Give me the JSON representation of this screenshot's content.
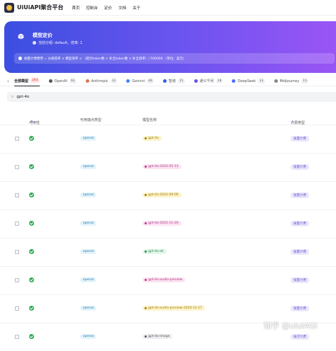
{
  "header": {
    "brand": "UiUiAPI聚合平台",
    "nav": [
      "首页",
      "控制台",
      "定价",
      "文档",
      "关于"
    ]
  },
  "hero": {
    "title": "模型定价",
    "subtitle": "当前分组: default，倍率: 1",
    "formula": "按量计费费用 = 分组倍率 × 模型倍率 × （提示token数 + 补全token数 × 补全倍率）/ 500000 （单位：美元）"
  },
  "tabs": [
    {
      "label": "全部模型",
      "count": "283",
      "color": "#1c1f23"
    },
    {
      "label": "OpenAI",
      "count": "92",
      "color": "#555555"
    },
    {
      "label": "Anthropic",
      "count": "12",
      "color": "#d97757"
    },
    {
      "label": "Gemini",
      "count": "48",
      "color": "#4285f4"
    },
    {
      "label": "智谱",
      "count": "15",
      "color": "#3859ff"
    },
    {
      "label": "通义千问",
      "count": "18",
      "color": "#6e4df2"
    },
    {
      "label": "DeepSeek",
      "count": "13",
      "color": "#4d6bfe"
    },
    {
      "label": "Midjourney",
      "count": "15",
      "color": "#888888"
    }
  ],
  "search": {
    "value": "gpt-4o"
  },
  "table": {
    "columns": [
      "可用性",
      "可用端点类型",
      "模型名称",
      "计费类型"
    ],
    "rows": [
      {
        "endpoint": "openai",
        "model": "gpt-4o",
        "model_bg": "#fbf3c8",
        "model_fg": "#a07a10",
        "billing": "按量计费"
      },
      {
        "endpoint": "openai",
        "model": "gpt-4o-2024-05-13",
        "model_bg": "#fbe3f2",
        "model_fg": "#b13b86",
        "billing": "按量计费"
      },
      {
        "endpoint": "openai",
        "model": "gpt-4o-2024-08-06",
        "model_bg": "#fbf3c8",
        "model_fg": "#a07a10",
        "billing": "按量计费"
      },
      {
        "endpoint": "openai",
        "model": "gpt-4o-2024-11-20",
        "model_bg": "#fbe3f2",
        "model_fg": "#b13b86",
        "billing": "按量计费"
      },
      {
        "endpoint": "openai",
        "model": "gpt-4o-all",
        "model_bg": "#e2f6ea",
        "model_fg": "#2e8a50",
        "billing": "按量计费"
      },
      {
        "endpoint": "openai",
        "model": "gpt-4o-audio-preview",
        "model_bg": "#fbe3f2",
        "model_fg": "#b13b86",
        "billing": "按量计费"
      },
      {
        "endpoint": "openai",
        "model": "gpt-4o-audio-preview-2024-12-17",
        "model_bg": "#fbf3c8",
        "model_fg": "#a07a10",
        "billing": "按量计费"
      },
      {
        "endpoint": "openai",
        "model": "gpt-4o-image",
        "model_bg": "#eceef1",
        "model_fg": "#555555",
        "billing": "按次计费"
      }
    ]
  },
  "watermark": "知乎 @uiuiAGI"
}
